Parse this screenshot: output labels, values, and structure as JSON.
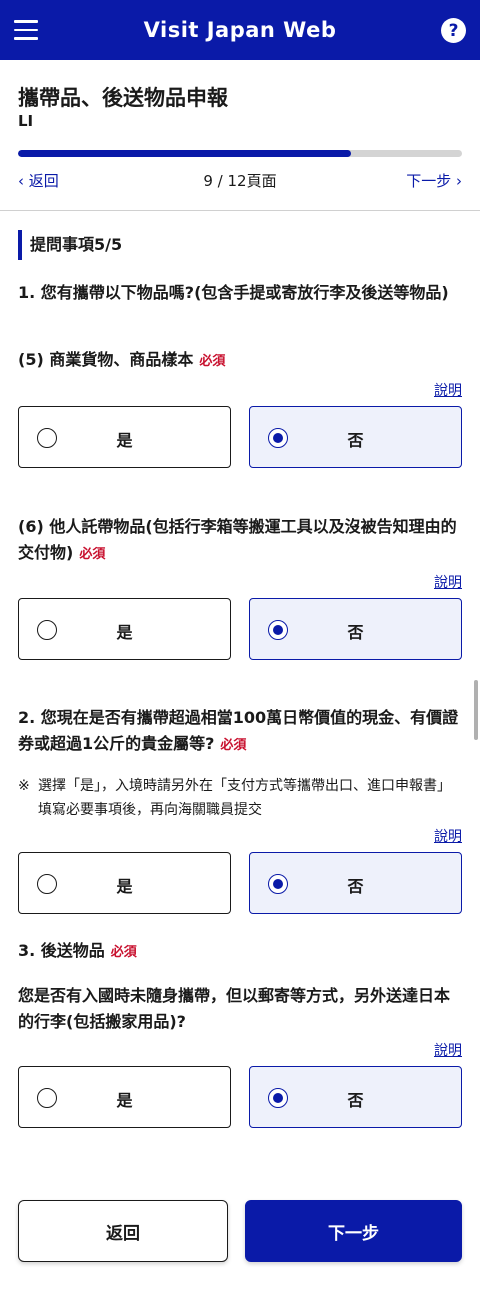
{
  "header": {
    "title": "Visit Japan Web",
    "help_label": "?"
  },
  "page": {
    "title": "攜帶品、後送物品申報",
    "subtitle": "LI"
  },
  "progress": {
    "current": 9,
    "total": 12,
    "fraction": 0.75
  },
  "nav": {
    "back": "返回",
    "page_indicator": "9 / 12頁面",
    "next": "下一步"
  },
  "section": {
    "heading": "提問事項5/5"
  },
  "q1": {
    "text": "1. 您有攜帶以下物品嗎?(包含手提或寄放行李及後送等物品)",
    "item5": {
      "text": "(5) 商業貨物、商品樣本",
      "required": "必須",
      "explain": "說明",
      "yes": "是",
      "no": "否",
      "selected": "no"
    },
    "item6": {
      "text": "(6) 他人託帶物品(包括行李箱等搬運工具以及沒被告知理由的交付物)",
      "required": "必須",
      "explain": "說明",
      "yes": "是",
      "no": "否",
      "selected": "no"
    }
  },
  "q2": {
    "text": "2. 您現在是否有攜帶超過相當100萬日幣價值的現金、有價證券或超過1公斤的貴金屬等?",
    "required": "必須",
    "note_mark": "※",
    "note": "選擇「是」，入境時請另外在「支付方式等攜帶出口、進口申報書」填寫必要事項後，再向海關職員提交",
    "explain": "說明",
    "yes": "是",
    "no": "否",
    "selected": "no"
  },
  "q3": {
    "text": "3. 後送物品",
    "required": "必須",
    "question": "您是否有入國時未隨身攜帶，但以郵寄等方式，另外送達日本的行李(包括搬家用品)?",
    "explain": "說明",
    "yes": "是",
    "no": "否",
    "selected": "no"
  },
  "footer": {
    "back": "返回",
    "next": "下一步"
  }
}
